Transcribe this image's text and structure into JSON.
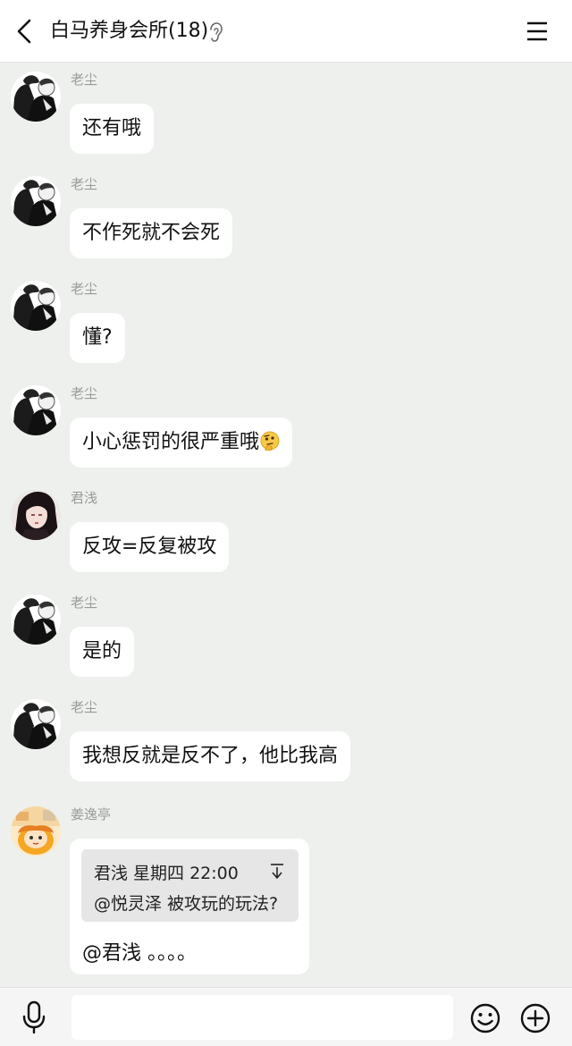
{
  "header": {
    "title": "白马养身会所(18)",
    "back_icon": "back-arrow-icon",
    "mute_icon": "ear-icon",
    "menu_icon": "menu-icon"
  },
  "messages": [
    {
      "sender": "老尘",
      "avatar": "avatar-laochen",
      "text": "还有哦"
    },
    {
      "sender": "老尘",
      "avatar": "avatar-laochen",
      "text": "不作死就不会死"
    },
    {
      "sender": "老尘",
      "avatar": "avatar-laochen",
      "text": "懂?"
    },
    {
      "sender": "老尘",
      "avatar": "avatar-laochen",
      "text": "小心惩罚的很严重哦",
      "emoji": "thinking-face-emoji"
    },
    {
      "sender": "君浅",
      "avatar": "avatar-junqian",
      "text": "反攻=反复被攻"
    },
    {
      "sender": "老尘",
      "avatar": "avatar-laochen",
      "text": "是的"
    },
    {
      "sender": "老尘",
      "avatar": "avatar-laochen",
      "text": "我想反就是反不了，他比我高"
    },
    {
      "sender": "姜逸亭",
      "avatar": "avatar-jiangyiting",
      "quote": {
        "meta": "君浅 星期四 22:00",
        "text": "@悦灵泽 被攻玩的玩法?",
        "arrow_icon": "jump-to-quote-icon"
      },
      "text": "@君浅 。。。。"
    }
  ],
  "input_bar": {
    "voice_icon": "microphone-icon",
    "input_value": "",
    "emoji_icon": "smiley-icon",
    "more_icon": "plus-icon"
  }
}
